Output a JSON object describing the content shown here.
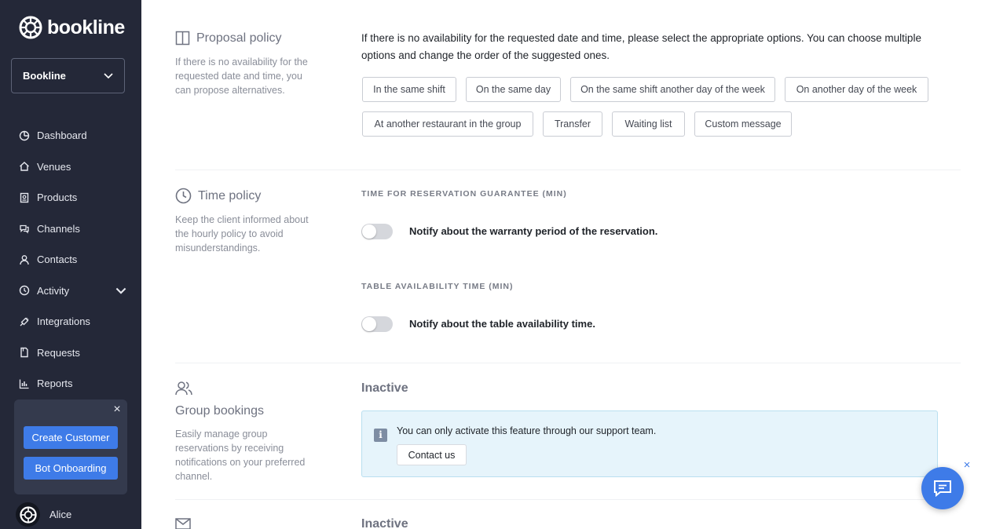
{
  "brand": {
    "name": "bookline"
  },
  "sidebar": {
    "org_select": "Bookline",
    "items": [
      {
        "label": "Dashboard",
        "icon": "dashboard-icon"
      },
      {
        "label": "Venues",
        "icon": "home-icon"
      },
      {
        "label": "Products",
        "icon": "products-icon"
      },
      {
        "label": "Channels",
        "icon": "chat-bubbles-icon"
      },
      {
        "label": "Contacts",
        "icon": "person-icon"
      },
      {
        "label": "Activity",
        "icon": "activity-icon"
      },
      {
        "label": "Integrations",
        "icon": "plug-icon"
      },
      {
        "label": "Requests",
        "icon": "document-icon"
      },
      {
        "label": "Reports",
        "icon": "bar-chart-icon"
      }
    ],
    "promo": {
      "create_customer": "Create Customer",
      "bot_onboarding": "Bot Onboarding"
    },
    "user": {
      "name": "Alice"
    }
  },
  "proposal": {
    "title": "Proposal policy",
    "description": "If there is no availability for the requested date and time, you can propose alternatives.",
    "intro": "If there is no availability for the requested date and time, please select the appropriate options. You can choose multiple options and change the order of the suggested ones.",
    "options": [
      "In the same shift",
      "On the same day",
      "On the same shift another day of the week",
      "On another day of the week",
      "At another restaurant in the group",
      "Transfer",
      "Waiting list",
      "Custom message"
    ]
  },
  "time_policy": {
    "title": "Time policy",
    "description": "Keep the client informed about the hourly policy to avoid misunderstandings.",
    "guarantee_label": "TIME FOR RESERVATION GUARANTEE (MIN)",
    "guarantee_toggle": "Notify about the warranty period of the reservation.",
    "availability_label": "TABLE AVAILABILITY TIME (MIN)",
    "availability_toggle": "Notify about the table availability time."
  },
  "group_bookings": {
    "title": "Group bookings",
    "description": "Easily manage group reservations by receiving notifications on your preferred channel.",
    "status": "Inactive",
    "info": "You can only activate this feature through our support team.",
    "contact": "Contact us"
  },
  "next_section": {
    "status": "Inactive"
  }
}
